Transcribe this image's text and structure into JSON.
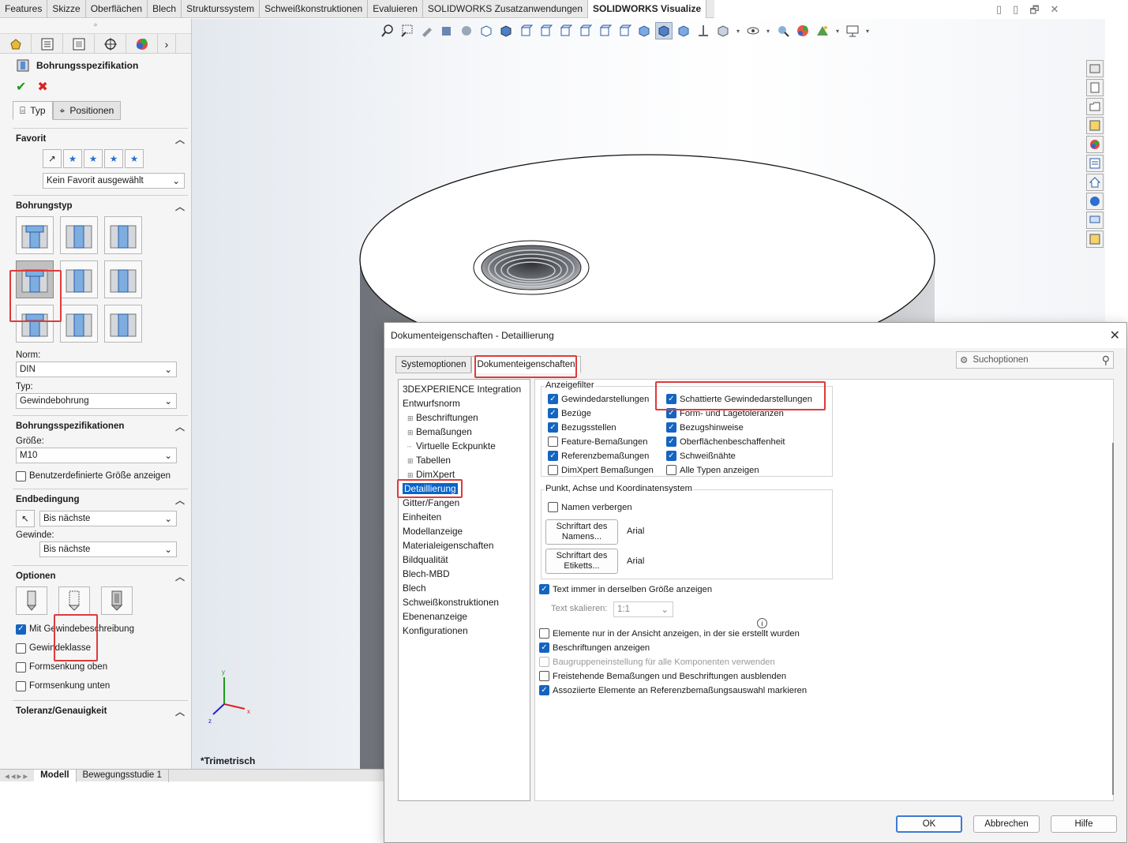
{
  "ribbon": {
    "tabs": [
      "Features",
      "Skizze",
      "Oberflächen",
      "Blech",
      "Strukturssystem",
      "Schweißkonstruktionen",
      "Evaluieren",
      "SOLIDWORKS Zusatzanwendungen",
      "SOLIDWORKS Visualize"
    ],
    "active_tab": "SOLIDWORKS Visualize"
  },
  "property_manager": {
    "title": "Bohrungsspezifikation",
    "ok_icon": "check-icon",
    "cancel_icon": "x-icon",
    "tabs": [
      {
        "label": "Typ",
        "active": true
      },
      {
        "label": "Positionen",
        "active": false
      }
    ],
    "favorit": {
      "title": "Favorit",
      "select_value": "Kein Favorit ausgewählt"
    },
    "bohrungstyp": {
      "title": "Bohrungstyp",
      "selected_index": 3
    },
    "norm": {
      "label": "Norm:",
      "value": "DIN"
    },
    "typ": {
      "label": "Typ:",
      "value": "Gewindebohrung"
    },
    "spezifikationen": {
      "title": "Bohrungsspezifikationen",
      "size_label": "Größe:",
      "size_value": "M10",
      "custom_size_label": "Benutzerdefinierte Größe anzeigen",
      "custom_size_checked": false
    },
    "endbedingung": {
      "title": "Endbedingung",
      "value": "Bis nächste",
      "gewinde_label": "Gewinde:",
      "gewinde_value": "Bis nächste"
    },
    "optionen": {
      "title": "Optionen",
      "selected_index": 1,
      "checks": [
        {
          "label": "Mit Gewindebeschreibung",
          "checked": true
        },
        {
          "label": "Gewindeklasse",
          "checked": false
        },
        {
          "label": "Formsenkung oben",
          "checked": false
        },
        {
          "label": "Formsenkung unten",
          "checked": false
        }
      ]
    },
    "toleranz": {
      "title": "Toleranz/Genauigkeit"
    }
  },
  "viewport": {
    "view_label": "*Trimetrisch",
    "axis_x": "x",
    "axis_y": "y",
    "axis_z": "z"
  },
  "bottom_tabs": [
    {
      "label": "Modell",
      "active": true
    },
    {
      "label": "Bewegungsstudie 1",
      "active": false
    }
  ],
  "dialog": {
    "title": "Dokumenteigenschaften - Detaillierung",
    "tabs": [
      {
        "label": "Systemoptionen",
        "active": false
      },
      {
        "label": "Dokumenteigenschaften",
        "active": true
      }
    ],
    "search_placeholder": "Suchoptionen",
    "tree": [
      {
        "label": "3DEXPERIENCE Integration",
        "level": 0,
        "expand": false
      },
      {
        "label": "Entwurfsnorm",
        "level": 0,
        "expand": false
      },
      {
        "label": "Beschriftungen",
        "level": 1,
        "expand": true
      },
      {
        "label": "Bemaßungen",
        "level": 1,
        "expand": true
      },
      {
        "label": "Virtuelle Eckpunkte",
        "level": 1,
        "expand": false
      },
      {
        "label": "Tabellen",
        "level": 1,
        "expand": true
      },
      {
        "label": "DimXpert",
        "level": 1,
        "expand": true
      },
      {
        "label": "Detaillierung",
        "level": 0,
        "expand": false,
        "selected": true
      },
      {
        "label": "Gitter/Fangen",
        "level": 0,
        "expand": false
      },
      {
        "label": "Einheiten",
        "level": 0,
        "expand": false
      },
      {
        "label": "Modellanzeige",
        "level": 0,
        "expand": false
      },
      {
        "label": "Materialeigenschaften",
        "level": 0,
        "expand": false
      },
      {
        "label": "Bildqualität",
        "level": 0,
        "expand": false
      },
      {
        "label": "Blech-MBD",
        "level": 0,
        "expand": false
      },
      {
        "label": "Blech",
        "level": 0,
        "expand": false
      },
      {
        "label": "Schweißkonstruktionen",
        "level": 0,
        "expand": false
      },
      {
        "label": "Ebenenanzeige",
        "level": 0,
        "expand": false
      },
      {
        "label": "Konfigurationen",
        "level": 0,
        "expand": false
      }
    ],
    "anzeigefilter": {
      "title": "Anzeigefilter",
      "left": [
        {
          "label": "Gewindedarstellungen",
          "checked": true
        },
        {
          "label": "Bezüge",
          "checked": true
        },
        {
          "label": "Bezugsstellen",
          "checked": true
        },
        {
          "label": "Feature-Bemaßungen",
          "checked": false
        },
        {
          "label": "Referenzbemaßungen",
          "checked": true
        },
        {
          "label": "DimXpert Bemaßungen",
          "checked": false
        }
      ],
      "right": [
        {
          "label": "Schattierte Gewindedarstellungen",
          "checked": true
        },
        {
          "label": "Form- und Lagetoleranzen",
          "checked": true
        },
        {
          "label": "Bezugshinweise",
          "checked": true
        },
        {
          "label": "Oberflächenbeschaffenheit",
          "checked": true
        },
        {
          "label": "Schweißnähte",
          "checked": true
        },
        {
          "label": "Alle Typen anzeigen",
          "checked": false
        }
      ]
    },
    "punkt": {
      "title": "Punkt, Achse und Koordinatensystem",
      "hide_names_label": "Namen verbergen",
      "hide_names_checked": false,
      "font_name_btn": "Schriftart des Namens...",
      "font_name_value": "Arial",
      "font_label_btn": "Schriftart des Etiketts...",
      "font_label_value": "Arial"
    },
    "text_same_size": {
      "label": "Text immer in derselben Größe anzeigen",
      "checked": true
    },
    "text_scale": {
      "label": "Text skalieren:",
      "value": "1:1"
    },
    "options": [
      {
        "label": "Elemente nur in der Ansicht anzeigen, in der sie erstellt wurden",
        "checked": false,
        "disabled": false
      },
      {
        "label": "Beschriftungen anzeigen",
        "checked": true,
        "disabled": false
      },
      {
        "label": "Baugruppeneinstellung für alle Komponenten verwenden",
        "checked": false,
        "disabled": true
      },
      {
        "label": "Freistehende Bemaßungen und Beschriftungen ausblenden",
        "checked": false,
        "disabled": false
      },
      {
        "label": "Assoziierte Elemente an Referenzbemaßungsauswahl markieren",
        "checked": true,
        "disabled": false
      }
    ],
    "buttons": {
      "ok": "OK",
      "cancel": "Abbrechen",
      "help": "Hilfe"
    }
  }
}
